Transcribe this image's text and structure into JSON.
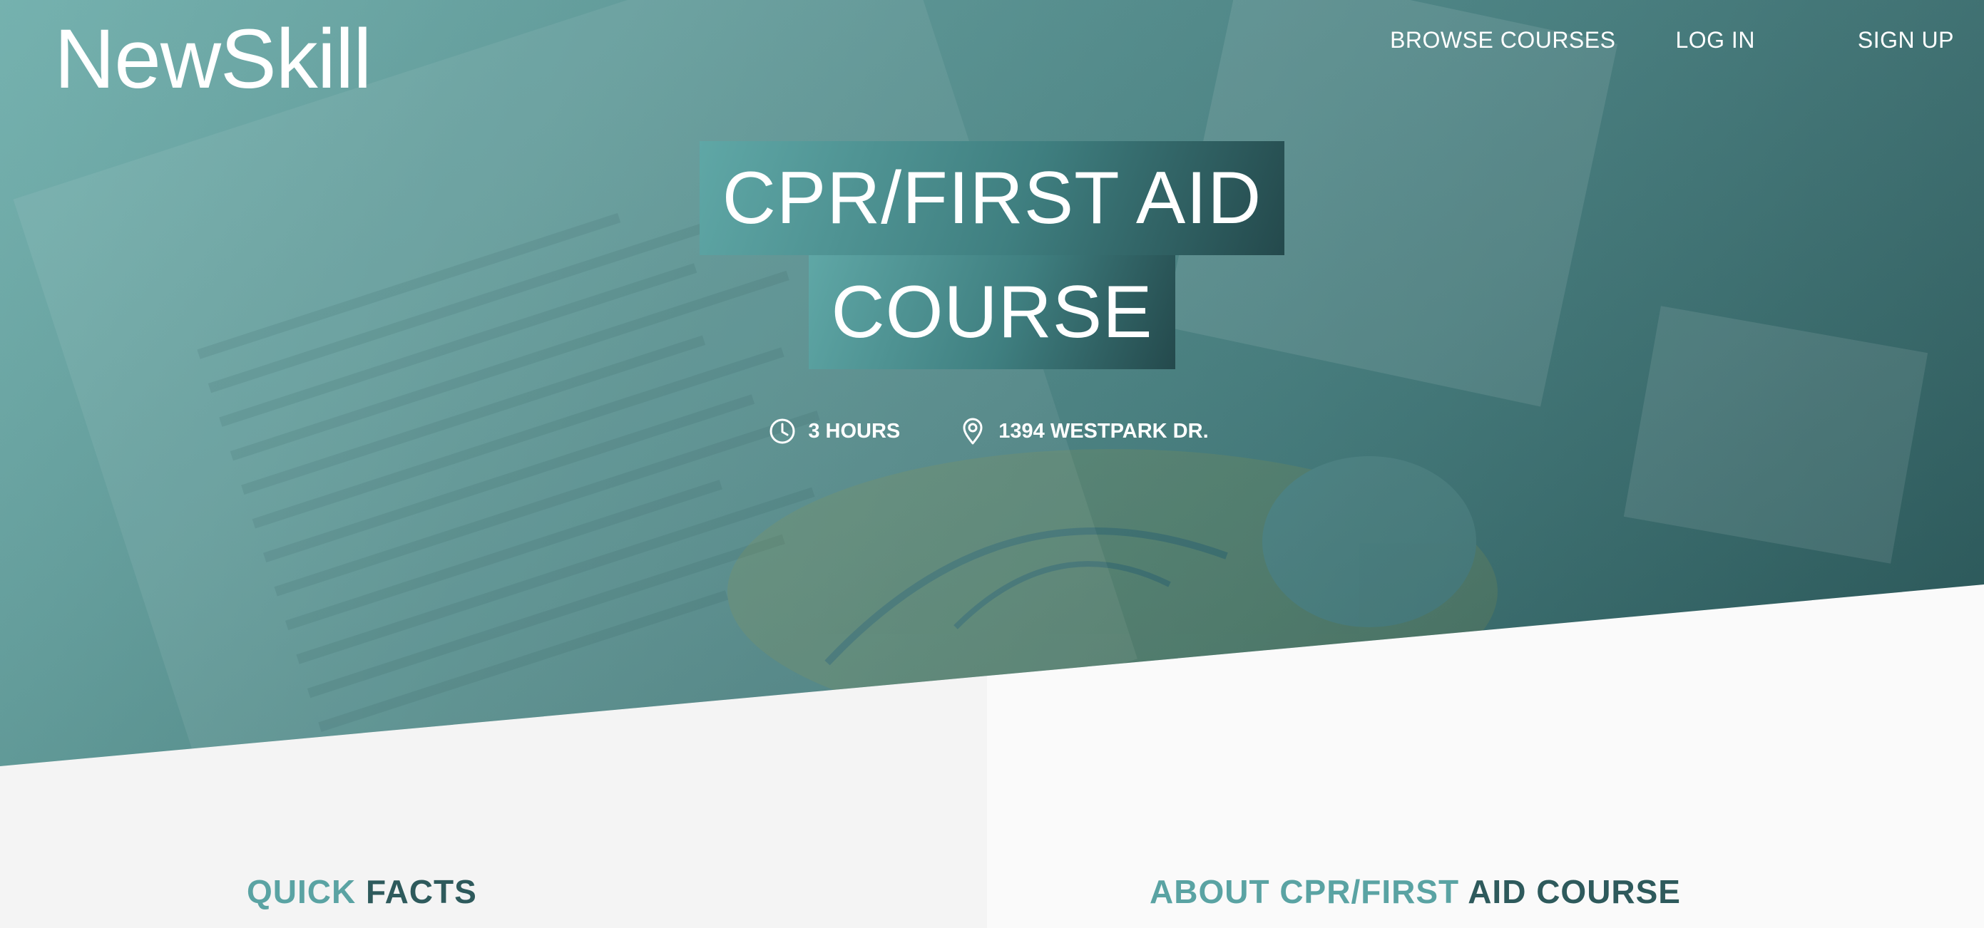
{
  "brand": {
    "name": "NewSkill"
  },
  "nav": {
    "items": [
      {
        "label": "BROWSE COURSES"
      },
      {
        "label": "LOG IN"
      },
      {
        "label": "SIGN UP"
      }
    ]
  },
  "hero": {
    "title_line1": "CPR/FIRST AID",
    "title_line2": "COURSE",
    "duration": "3 HOURS",
    "location": "1394 WESTPARK DR."
  },
  "sections": {
    "quick_facts": {
      "word1": "QUICK",
      "word2": "FACTS"
    },
    "about": {
      "word1": "ABOUT",
      "word2": "CPR/FIRST",
      "word3": "AID COURSE"
    }
  },
  "icons": {
    "duration": "clock-icon",
    "location": "map-pin-icon"
  },
  "colors": {
    "hero_teal": "#4f8f8e",
    "accent": "#5aa3a3",
    "dark_teal": "#2e5a5c",
    "title_bg_dark": "#24494c"
  }
}
